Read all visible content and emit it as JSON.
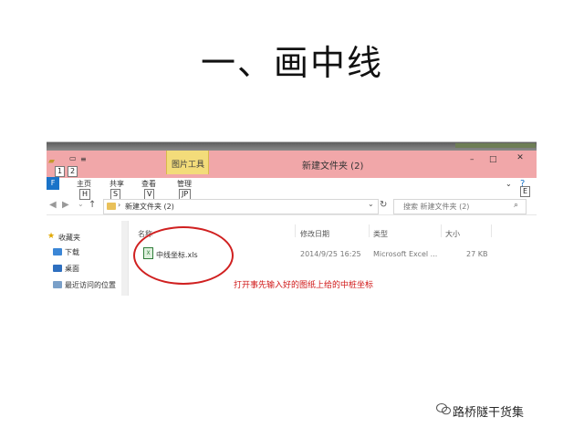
{
  "slide": {
    "title": "一、画中线"
  },
  "window": {
    "title": "新建文件夹 (2)",
    "quick_access_keys": [
      "1",
      "2"
    ],
    "context_tab": "图片工具",
    "tabs": [
      {
        "label": "主页",
        "key": "H"
      },
      {
        "label": "共享",
        "key": "S"
      },
      {
        "label": "查看",
        "key": "V"
      },
      {
        "label": "管理",
        "key": "JP"
      }
    ],
    "file_button": "F",
    "help_key": "E",
    "controls": {
      "minimize": "–",
      "maximize": "□",
      "close": "✕"
    }
  },
  "address": {
    "path": "新建文件夹 (2)",
    "search_placeholder": "搜索 新建文件夹 (2)"
  },
  "sidebar": {
    "items": [
      {
        "label": "收藏夹",
        "icon": "star-icon"
      },
      {
        "label": "下载",
        "icon": "download-folder-icon"
      },
      {
        "label": "桌面",
        "icon": "desktop-icon"
      },
      {
        "label": "最近访问的位置",
        "icon": "recent-places-icon"
      }
    ]
  },
  "file_list": {
    "columns": [
      "名称",
      "修改日期",
      "类型",
      "大小"
    ],
    "rows": [
      {
        "name": "中线坐标.xls",
        "modified": "2014/9/25 16:25",
        "type": "Microsoft Excel ...",
        "size": "27 KB"
      }
    ]
  },
  "annotation": {
    "note": "打开事先输入好的图纸上给的中桩坐标",
    "highlight_color": "#d02020"
  },
  "watermark": {
    "text": "路桥隧干货集"
  }
}
